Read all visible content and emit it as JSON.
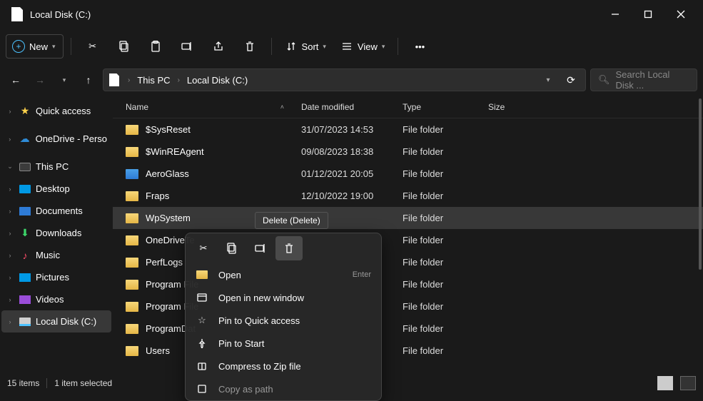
{
  "window": {
    "title": "Local Disk  (C:)"
  },
  "toolbar": {
    "new": "New",
    "sort": "Sort",
    "view": "View"
  },
  "address": {
    "root": "This PC",
    "current": "Local Disk  (C:)"
  },
  "search": {
    "placeholder": "Search Local Disk  ..."
  },
  "sidebar": {
    "quick": "Quick access",
    "onedrive": "OneDrive - Perso",
    "thispc": "This PC",
    "desktop": "Desktop",
    "documents": "Documents",
    "downloads": "Downloads",
    "music": "Music",
    "pictures": "Pictures",
    "videos": "Videos",
    "localdisk": "Local Disk  (C:)"
  },
  "columns": {
    "name": "Name",
    "date": "Date modified",
    "type": "Type",
    "size": "Size"
  },
  "rows": [
    {
      "name": "$SysReset",
      "date": "31/07/2023 14:53",
      "type": "File folder",
      "icon": "yellow"
    },
    {
      "name": "$WinREAgent",
      "date": "09/08/2023 18:38",
      "type": "File folder",
      "icon": "yellow"
    },
    {
      "name": "AeroGlass",
      "date": "01/12/2021 20:05",
      "type": "File folder",
      "icon": "blue"
    },
    {
      "name": "Fraps",
      "date": "12/10/2022 19:00",
      "type": "File folder",
      "icon": "yellow"
    },
    {
      "name": "WpSystem",
      "date": "",
      "type": "File folder",
      "icon": "yellow",
      "selected": true
    },
    {
      "name": "OneDriveTe",
      "date": "",
      "type": "File folder",
      "icon": "yellow"
    },
    {
      "name": "PerfLogs",
      "date": "",
      "type": "File folder",
      "icon": "yellow"
    },
    {
      "name": "Program File",
      "date": "",
      "type": "File folder",
      "icon": "yellow"
    },
    {
      "name": "Program File",
      "date": "",
      "type": "File folder",
      "icon": "yellow"
    },
    {
      "name": "ProgramDat",
      "date": "",
      "type": "File folder",
      "icon": "yellow"
    },
    {
      "name": "Users",
      "date": "",
      "type": "File folder",
      "icon": "yellow"
    }
  ],
  "tooltip": "Delete (Delete)",
  "context": {
    "open": "Open",
    "open_hint": "Enter",
    "new_window": "Open in new window",
    "pin_quick": "Pin to Quick access",
    "pin_start": "Pin to Start",
    "zip": "Compress to Zip file",
    "copy_path": "Copy as path"
  },
  "status": {
    "count": "15 items",
    "selected": "1 item selected"
  }
}
